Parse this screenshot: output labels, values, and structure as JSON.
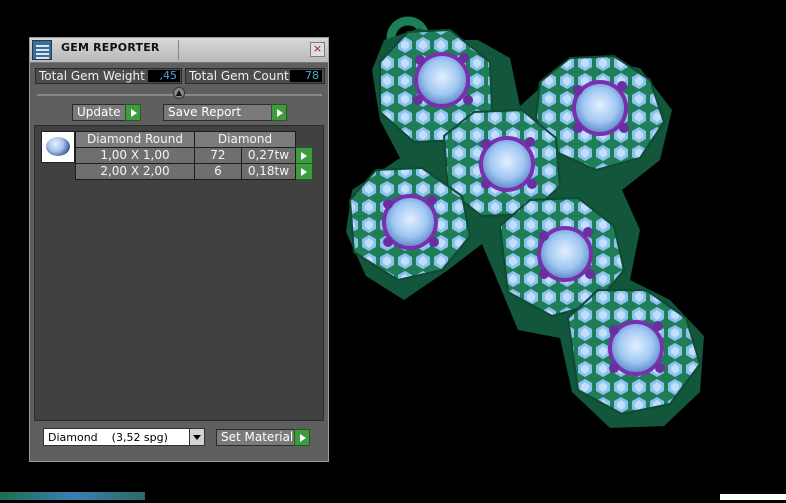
{
  "window": {
    "title": "GEM REPORTER",
    "close_glyph": "×"
  },
  "stats": {
    "total_weight_label": "Total Gem Weight",
    "total_weight_value": ",45",
    "total_count_label": "Total Gem Count",
    "total_count_value": "78"
  },
  "buttons": {
    "update": "Update",
    "save_report": "Save Report",
    "set_material": "Set Material"
  },
  "table": {
    "header": {
      "shape": "Diamond Round",
      "material": "Diamond"
    },
    "rows": [
      {
        "size": "1,00 X 1,00",
        "count": "72",
        "weight": "0,27tw"
      },
      {
        "size": "2,00 X 2,00",
        "count": "6",
        "weight": "0,18tw"
      }
    ]
  },
  "material_select": {
    "value": "Diamond    (3,52 spg)"
  },
  "colors": {
    "metal": "#1e8a5c",
    "pave": "#8fc7f2",
    "accent_gem": "#6b2ea0",
    "action_green": "#3f9b3f"
  },
  "viewport": {
    "model": "cross-pendant"
  }
}
